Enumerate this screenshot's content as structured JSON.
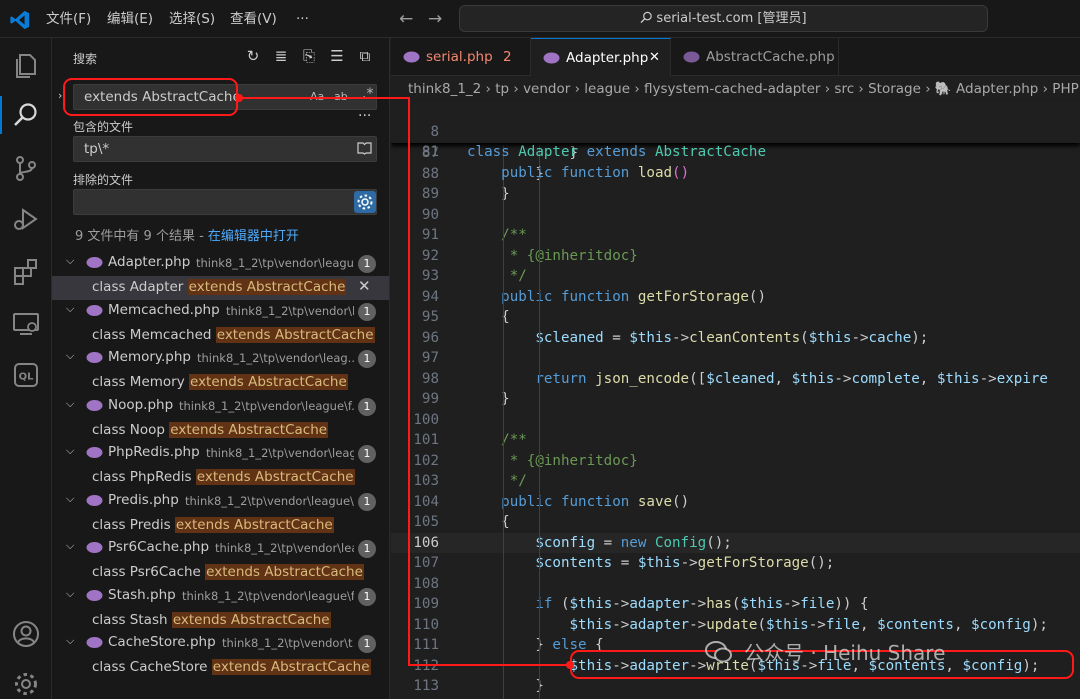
{
  "menu": [
    "文件(F)",
    "编辑(E)",
    "选择(S)",
    "查看(V)",
    "···"
  ],
  "command_center": "serial-test.com [管理员]",
  "search_panel": {
    "title": "搜索",
    "query": "extends AbstractCache",
    "options": [
      "Aa",
      "ab"
    ],
    "include_label": "包含的文件",
    "include_value": "tp\\*",
    "exclude_label": "排除的文件",
    "summary": "9 文件中有 9 个结果 - ",
    "open_in_editor": "在编辑器中打开",
    "results": [
      {
        "file": "Adapter.php",
        "path": "think8_1_2\\tp\\vendor\\leagu...",
        "count": "1",
        "prefix": "class Adapter ",
        "match": "extends AbstractCache",
        "selected": true
      },
      {
        "file": "Memcached.php",
        "path": "think8_1_2\\tp\\vendor\\l...",
        "count": "1",
        "prefix": "class Memcached ",
        "match": "extends AbstractCache"
      },
      {
        "file": "Memory.php",
        "path": "think8_1_2\\tp\\vendor\\leag...",
        "count": "1",
        "prefix": "class Memory ",
        "match": "extends AbstractCache"
      },
      {
        "file": "Noop.php",
        "path": "think8_1_2\\tp\\vendor\\league\\f...",
        "count": "1",
        "prefix": "class Noop ",
        "match": "extends AbstractCache"
      },
      {
        "file": "PhpRedis.php",
        "path": "think8_1_2\\tp\\vendor\\leag...",
        "count": "1",
        "prefix": "class PhpRedis ",
        "match": "extends AbstractCache"
      },
      {
        "file": "Predis.php",
        "path": "think8_1_2\\tp\\vendor\\league\\...",
        "count": "1",
        "prefix": "class Predis ",
        "match": "extends AbstractCache"
      },
      {
        "file": "Psr6Cache.php",
        "path": "think8_1_2\\tp\\vendor\\lea...",
        "count": "1",
        "prefix": "class Psr6Cache ",
        "match": "extends AbstractCache"
      },
      {
        "file": "Stash.php",
        "path": "think8_1_2\\tp\\vendor\\league\\f...",
        "count": "1",
        "prefix": "class Stash ",
        "match": "extends AbstractCache"
      },
      {
        "file": "CacheStore.php",
        "path": "think8_1_2\\tp\\vendor\\t...",
        "count": "1",
        "prefix": "class CacheStore ",
        "match": "extends AbstractCache"
      }
    ]
  },
  "tabs": [
    {
      "label": "serial.php",
      "badge": "2"
    },
    {
      "label": "Adapter.php",
      "close": "✕"
    },
    {
      "label": "AbstractCache.php"
    }
  ],
  "breadcrumb": "think8_1_2 › tp › vendor › league › flysystem-cached-adapter › src › Storage › 🐘 Adapter.php › PHP Intelephense",
  "sticky_lines": [
    {
      "n": "8",
      "t": "class Adapter extends AbstractCache"
    },
    {
      "n": "81",
      "t": "    public function load()"
    }
  ],
  "code_lines": [
    {
      "n": "87",
      "t": "            }"
    },
    {
      "n": "88",
      "t": "        }"
    },
    {
      "n": "89",
      "t": "    }"
    },
    {
      "n": "90",
      "t": ""
    },
    {
      "n": "91",
      "t": "    /**"
    },
    {
      "n": "92",
      "t": "     * {@inheritdoc}"
    },
    {
      "n": "93",
      "t": "     */"
    },
    {
      "n": "94",
      "t": "    public function getForStorage()"
    },
    {
      "n": "95",
      "t": "    {"
    },
    {
      "n": "96",
      "t": "        $cleaned = $this->cleanContents($this->cache);"
    },
    {
      "n": "97",
      "t": ""
    },
    {
      "n": "98",
      "t": "        return json_encode([$cleaned, $this->complete, $this->expire"
    },
    {
      "n": "99",
      "t": "    }"
    },
    {
      "n": "100",
      "t": ""
    },
    {
      "n": "101",
      "t": "    /**"
    },
    {
      "n": "102",
      "t": "     * {@inheritdoc}"
    },
    {
      "n": "103",
      "t": "     */"
    },
    {
      "n": "104",
      "t": "    public function save()"
    },
    {
      "n": "105",
      "t": "    {"
    },
    {
      "n": "106",
      "t": "        $config = new Config();"
    },
    {
      "n": "107",
      "t": "        $contents = $this->getForStorage();"
    },
    {
      "n": "108",
      "t": ""
    },
    {
      "n": "109",
      "t": "        if ($this->adapter->has($this->file)) {"
    },
    {
      "n": "110",
      "t": "            $this->adapter->update($this->file, $contents, $config);"
    },
    {
      "n": "111",
      "t": "        } else {"
    },
    {
      "n": "112",
      "t": "            $this->adapter->write($this->file, $contents, $config);"
    },
    {
      "n": "113",
      "t": "        }"
    }
  ],
  "current_line": "106",
  "watermark": "公众号 · Heihu Share",
  "colors": {
    "accent": "#0078d4",
    "annotation": "#ff1a1a",
    "match_highlight": "#613214"
  }
}
